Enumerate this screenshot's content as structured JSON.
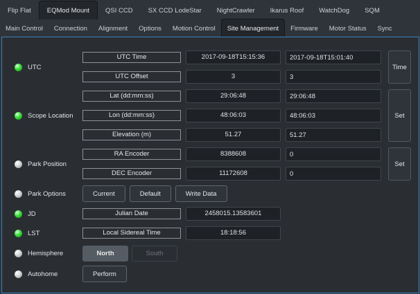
{
  "device_tabs": {
    "items": [
      "Flip Flat",
      "EQMod Mount",
      "QSI CCD",
      "SX CCD LodeStar",
      "NightCrawler",
      "Ikarus Roof",
      "WatchDog",
      "SQM"
    ],
    "selected": "EQMod Mount"
  },
  "group_tabs": {
    "items": [
      "Main Control",
      "Connection",
      "Alignment",
      "Options",
      "Motion Control",
      "Site Management",
      "Firmware",
      "Motor Status",
      "Sync"
    ],
    "selected": "Site Management"
  },
  "colors": {
    "accent_blue": "#3b82b8",
    "led_on": "#3adb3a",
    "led_off": "#d2d4d6",
    "field_bg": "#1e2226",
    "window_bg": "#2a2e33"
  },
  "groups": [
    {
      "name": "UTC",
      "led": "on",
      "action": "Time",
      "rows": [
        {
          "label": "UTC Time",
          "value": "2017-09-18T15:15:36",
          "input": "2017-09-18T15:01:40"
        },
        {
          "label": "UTC Offset",
          "value": "3",
          "input": "3"
        }
      ]
    },
    {
      "name": "Scope Location",
      "led": "on",
      "action": "Set",
      "rows": [
        {
          "label": "Lat (dd:mm:ss)",
          "value": "29:06:48",
          "input": "29:06:48"
        },
        {
          "label": "Lon (dd:mm:ss)",
          "value": "48:06:03",
          "input": "48:06:03"
        },
        {
          "label": "Elevation (m)",
          "value": "51.27",
          "input": "51.27"
        }
      ]
    },
    {
      "name": "Park Position",
      "led": "off",
      "action": "Set",
      "rows": [
        {
          "label": "RA Encoder",
          "value": "8388608",
          "input": "0"
        },
        {
          "label": "DEC Encoder",
          "value": "11172608",
          "input": "0"
        }
      ]
    },
    {
      "name": "Park Options",
      "led": "off",
      "buttons": [
        "Current",
        "Default",
        "Write Data"
      ]
    },
    {
      "name": "JD",
      "led": "on",
      "rows": [
        {
          "label": "Julian Date",
          "value": "2458015.13583601"
        }
      ]
    },
    {
      "name": "LST",
      "led": "on",
      "rows": [
        {
          "label": "Local Sidereal Time",
          "value": "18:18:56"
        }
      ]
    },
    {
      "name": "Hemisphere",
      "led": "off",
      "buttons": [
        "North",
        "South"
      ],
      "selected_button": "North"
    },
    {
      "name": "Autohome",
      "led": "off",
      "buttons": [
        "Perform"
      ]
    }
  ]
}
